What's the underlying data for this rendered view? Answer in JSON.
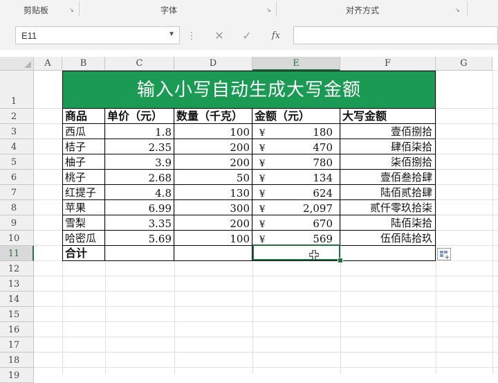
{
  "ribbon": {
    "groups": [
      {
        "label": "剪贴板"
      },
      {
        "label": "字体"
      },
      {
        "label": "对齐方式"
      }
    ]
  },
  "formula_bar": {
    "name_box": "E11",
    "cancel_icon": "✕",
    "enter_icon": "✓",
    "function_icon": "fx",
    "formula": ""
  },
  "columns": [
    "A",
    "B",
    "C",
    "D",
    "E",
    "F",
    "G"
  ],
  "rows": [
    "1",
    "2",
    "3",
    "4",
    "5",
    "6",
    "7",
    "8",
    "9",
    "10",
    "11",
    "12",
    "13",
    "14",
    "15",
    "16",
    "17",
    "18",
    "19"
  ],
  "selected_cell": "E11",
  "table": {
    "title": "输入小写自动生成大写金额",
    "headers": [
      "商品",
      "单价（元）",
      "数量（千克）",
      "金额（元）",
      "大写金额"
    ],
    "currency_symbol": "¥",
    "items": [
      {
        "name": "西瓜",
        "price": "1.8",
        "qty": "100",
        "amount": "180",
        "words": "壹佰捌拾"
      },
      {
        "name": "桔子",
        "price": "2.35",
        "qty": "200",
        "amount": "470",
        "words": "肆佰柒拾"
      },
      {
        "name": "柚子",
        "price": "3.9",
        "qty": "200",
        "amount": "780",
        "words": "柒佰捌拾"
      },
      {
        "name": "桃子",
        "price": "2.68",
        "qty": "50",
        "amount": "134",
        "words": "壹佰叁拾肆"
      },
      {
        "name": "红提子",
        "price": "4.8",
        "qty": "130",
        "amount": "624",
        "words": "陆佰贰拾肆"
      },
      {
        "name": "苹果",
        "price": "6.99",
        "qty": "300",
        "amount": "2,097",
        "words": "贰仟零玖拾柒"
      },
      {
        "name": "雪梨",
        "price": "3.35",
        "qty": "200",
        "amount": "670",
        "words": "陆佰柒拾"
      },
      {
        "name": "哈密瓜",
        "price": "5.69",
        "qty": "100",
        "amount": "569",
        "words": "伍佰陆拾玖"
      }
    ],
    "total_label": "合计"
  },
  "colors": {
    "title_band": "#1a9a52",
    "selection": "#217346"
  }
}
